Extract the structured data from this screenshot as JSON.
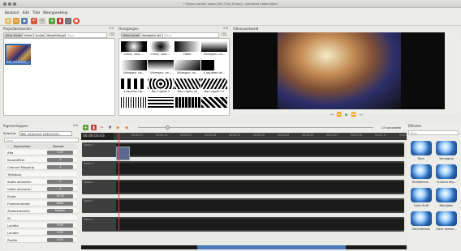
{
  "window": {
    "title": "* Project zonder naam [HD 720p 30 fps] - OpenShot Video Editor"
  },
  "menu": [
    "Bestand",
    "Edit",
    "Titel",
    "Weergave",
    "Help"
  ],
  "toolbar": {
    "icons": [
      "new-icon",
      "open-icon",
      "save-icon",
      "undo-icon",
      "redo-icon",
      "import-icon",
      "profile-icon",
      "fullscreen-icon",
      "export-icon"
    ]
  },
  "project": {
    "title": "Projectbestanden",
    "filters": [
      "Alles tonen",
      "Video",
      "Audio",
      "Afbeeldingen"
    ],
    "filter_placeholder": "Filter",
    "item": "IMG_20181020_..."
  },
  "transitions": {
    "title": "Overgangen",
    "filters": [
      "Alles tonen",
      "Veelgebruikt"
    ],
    "filter_placeholder": "Filter",
    "items": [
      "Cirkel, naar ...",
      "Cirkel, naar ...",
      "Fader",
      "Uitvegen, na...",
      "Uitvegen, na...",
      "Uitvegen, na...",
      "Uitvegen, na...",
      "4 squares lef...",
      "4 squares rig...",
      "Barr ripple 1",
      "Barr ripple 10",
      "Barr ripple 11"
    ]
  },
  "preview": {
    "title": "Videovoorbeeld",
    "zoom_label": "15 seconden"
  },
  "properties": {
    "title": "Eigenschappen",
    "selection_label": "Selectie:",
    "selection_value": "IMG_20181020_183042153...",
    "filter_placeholder": "Filter",
    "col_name": "Eigenschap",
    "col_value": "Waarde",
    "rows": [
      {
        "name": "Alfa",
        "value": "1.00"
      },
      {
        "name": "Kanaalfilter",
        "value": "-1"
      },
      {
        "name": "Channel Mapping",
        "value": "-1"
      },
      {
        "name": "Tijdsduur",
        "value": ""
      },
      {
        "name": "Audio activeren",
        "value": "-1"
      },
      {
        "name": "Video activeren",
        "value": "-1"
      },
      {
        "name": "Einde",
        "value": "16.00"
      },
      {
        "name": "Framenummer",
        "value": "Geen"
      },
      {
        "name": "Zwaartekracht",
        "value": "Midden"
      },
      {
        "name": "ID",
        "value": ""
      },
      {
        "name": "Locatie",
        "value": "0.00"
      },
      {
        "name": "Locatie",
        "value": "0.00"
      },
      {
        "name": "Positie",
        "value": "0.00"
      }
    ]
  },
  "timeline": {
    "timecode": "00:00:03:03",
    "tracks": [
      "Spoor 4",
      "Spoor 3",
      "Spoor 2",
      "Spoor 1",
      "Spoor 0"
    ],
    "ruler": [
      "00:00:07",
      "00:00:14",
      "00:00:21",
      "00:00:28",
      "00:00:35",
      "00:00:42",
      "00:00:49",
      "00:00:56",
      "00:01:03",
      "00:01:10",
      "00:01:17",
      "00:01:24"
    ]
  },
  "effects": {
    "title": "Effecten",
    "filter_placeholder": "Filter",
    "items": [
      "Bars",
      "Vervaging",
      "Helderheid...",
      "Chroma Key...",
      "Color Shift",
      "Bijsnijden",
      "De-interlace",
      "Kleur versch..."
    ]
  }
}
